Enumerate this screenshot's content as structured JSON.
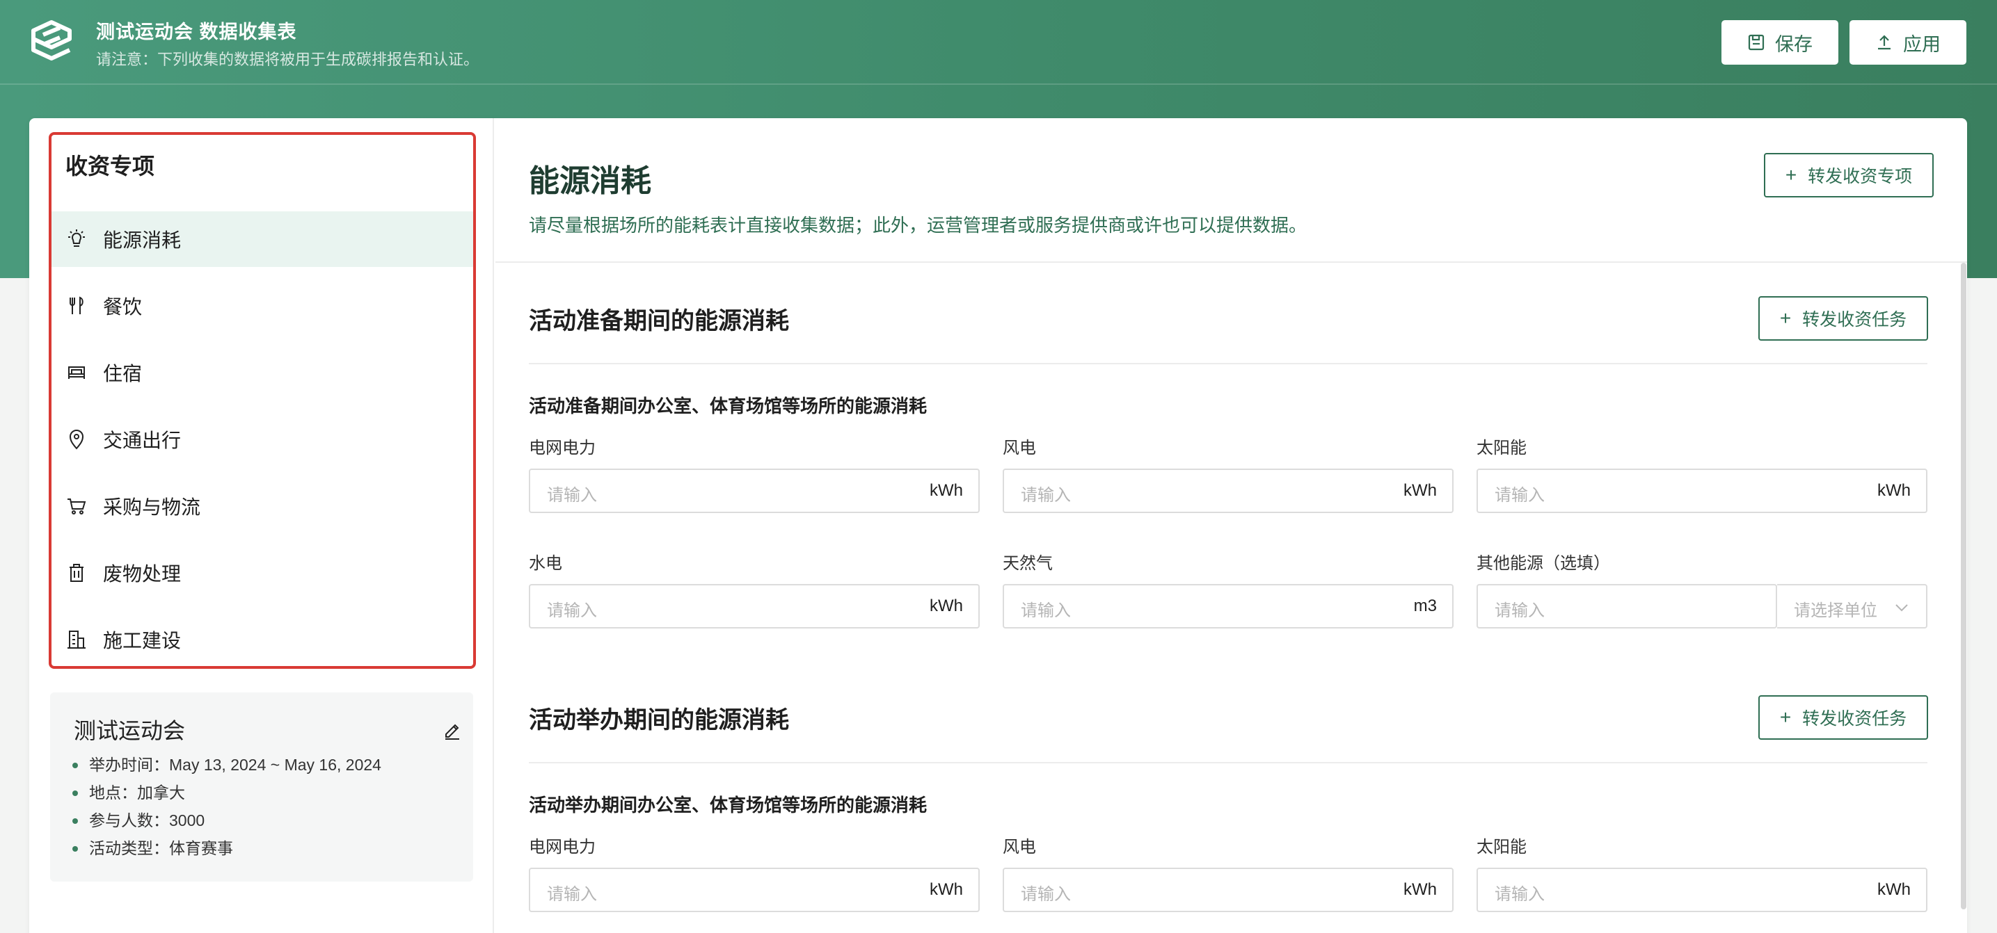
{
  "header": {
    "title": "测试运动会 数据收集表",
    "subtitle": "请注意：下列收集的数据将被用于生成碳排报告和认证。",
    "save_label": "保存",
    "apply_label": "应用"
  },
  "sidebar": {
    "title": "收资专项",
    "items": [
      {
        "label": "能源消耗",
        "icon": "bulb-icon"
      },
      {
        "label": "餐饮",
        "icon": "utensils-icon"
      },
      {
        "label": "住宿",
        "icon": "bed-icon"
      },
      {
        "label": "交通出行",
        "icon": "location-pin-icon"
      },
      {
        "label": "采购与物流",
        "icon": "cart-icon"
      },
      {
        "label": "废物处理",
        "icon": "trash-icon"
      },
      {
        "label": "施工建设",
        "icon": "building-icon"
      }
    ]
  },
  "event": {
    "name": "测试运动会",
    "details": [
      "举办时间：May 13, 2024 ~ May 16, 2024",
      "地点：加拿大",
      "参与人数：3000",
      "活动类型：体育赛事"
    ]
  },
  "main": {
    "title": "能源消耗",
    "description": "请尽量根据场所的能耗表计直接收集数据；此外，运营管理者或服务提供商或许也可以提供数据。",
    "forward_topic_label": "转发收资专项",
    "forward_task_label": "转发收资任务",
    "sections": [
      {
        "title": "活动准备期间的能源消耗",
        "subtitle": "活动准备期间办公室、体育场馆等场所的能源消耗",
        "fields": [
          {
            "label": "电网电力",
            "placeholder": "请输入",
            "unit": "kWh"
          },
          {
            "label": "风电",
            "placeholder": "请输入",
            "unit": "kWh"
          },
          {
            "label": "太阳能",
            "placeholder": "请输入",
            "unit": "kWh"
          },
          {
            "label": "水电",
            "placeholder": "请输入",
            "unit": "kWh"
          },
          {
            "label": "天然气",
            "placeholder": "请输入",
            "unit": "m3"
          },
          {
            "label": "其他能源（选填）",
            "placeholder": "请输入",
            "unit_placeholder": "请选择单位"
          }
        ]
      },
      {
        "title": "活动举办期间的能源消耗",
        "subtitle": "活动举办期间办公室、体育场馆等场所的能源消耗",
        "fields": [
          {
            "label": "电网电力",
            "placeholder": "请输入",
            "unit": "kWh"
          },
          {
            "label": "风电",
            "placeholder": "请输入",
            "unit": "kWh"
          },
          {
            "label": "太阳能",
            "placeholder": "请输入",
            "unit": "kWh"
          }
        ]
      }
    ]
  },
  "colors": {
    "brand": "#3f8a6a",
    "brand_dark": "#2f6e53",
    "active_bg": "#e9f4f0",
    "highlight_border": "#d93a34"
  }
}
